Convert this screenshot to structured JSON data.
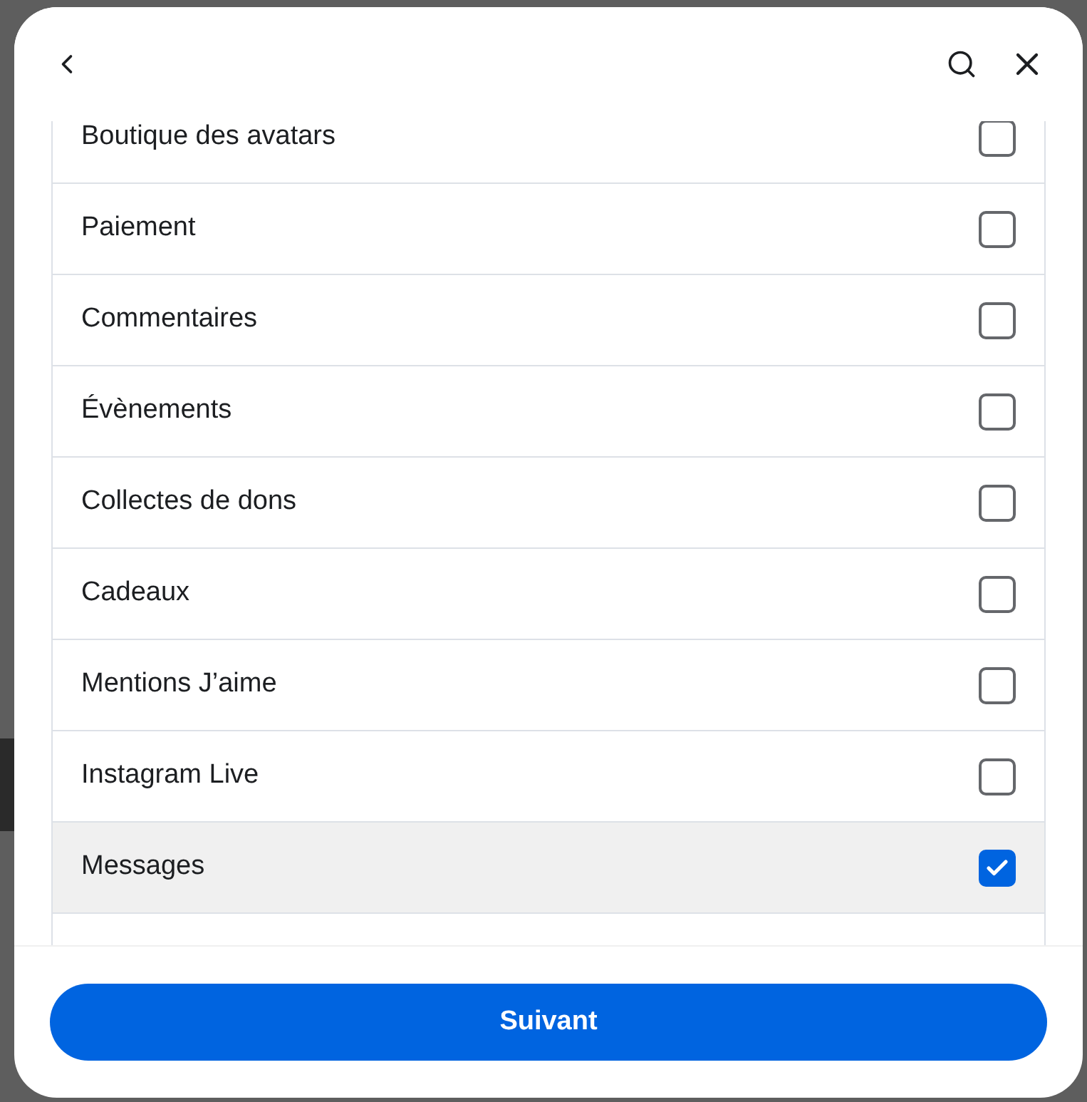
{
  "items": [
    {
      "label": "Boutique des avatars",
      "checked": false
    },
    {
      "label": "Paiement",
      "checked": false
    },
    {
      "label": "Commentaires",
      "checked": false
    },
    {
      "label": "Évènements",
      "checked": false
    },
    {
      "label": "Collectes de dons",
      "checked": false
    },
    {
      "label": "Cadeaux",
      "checked": false
    },
    {
      "label": "Mentions J’aime",
      "checked": false
    },
    {
      "label": "Instagram Live",
      "checked": false
    },
    {
      "label": "Messages",
      "checked": true
    }
  ],
  "button": "Suivant"
}
